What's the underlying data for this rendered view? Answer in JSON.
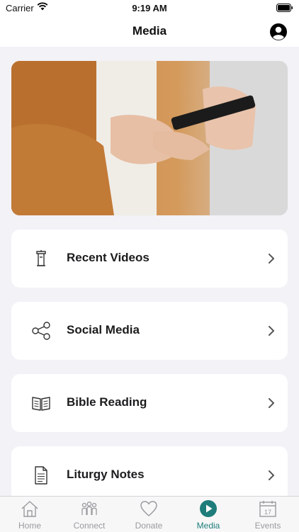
{
  "status_bar": {
    "carrier": "Carrier",
    "time": "9:19 AM"
  },
  "header": {
    "title": "Media"
  },
  "hero": {
    "alt": "Person holding a smartphone"
  },
  "menu": [
    {
      "label": "Recent Videos",
      "icon": "pulpit-icon"
    },
    {
      "label": "Social Media",
      "icon": "share-icon"
    },
    {
      "label": "Bible Reading",
      "icon": "book-icon"
    },
    {
      "label": "Liturgy Notes",
      "icon": "document-icon"
    }
  ],
  "tabs": [
    {
      "label": "Home",
      "icon": "home-icon"
    },
    {
      "label": "Connect",
      "icon": "people-icon"
    },
    {
      "label": "Donate",
      "icon": "heart-icon"
    },
    {
      "label": "Media",
      "icon": "play-icon",
      "active": true
    },
    {
      "label": "Events",
      "icon": "calendar-icon",
      "day": "17"
    }
  ],
  "colors": {
    "accent": "#1e7d7a",
    "inactive": "#9a9aa0",
    "background": "#f2f2f7"
  }
}
